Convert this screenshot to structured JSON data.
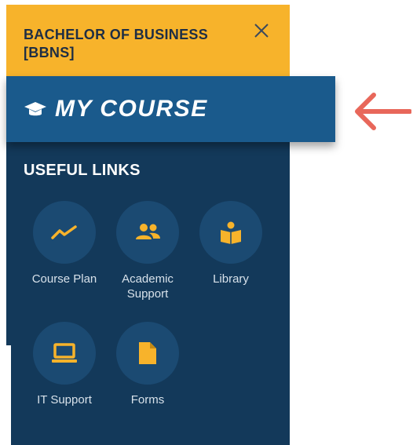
{
  "header": {
    "title_line1": "BACHELOR OF BUSINESS",
    "title_line2": "[BBNS]",
    "close_icon": "close-icon"
  },
  "course_band": {
    "label": "MY COURSE",
    "icon": "graduation-cap-icon"
  },
  "useful_links": {
    "title": "USEFUL LINKS",
    "items": [
      {
        "label": "Course Plan",
        "icon": "trend-line-icon"
      },
      {
        "label_line1": "Academic",
        "label_line2": "Support",
        "icon": "people-icon"
      },
      {
        "label": "Library",
        "icon": "reading-person-icon"
      },
      {
        "label": "IT Support",
        "icon": "laptop-icon"
      },
      {
        "label": "Forms",
        "icon": "document-icon"
      }
    ]
  },
  "annotation": {
    "icon": "left-arrow-icon",
    "color": "#e8675a"
  },
  "colors": {
    "panel": "#13395a",
    "header": "#f7b32b",
    "course_band": "#1a5a8c",
    "icon_accent": "#f7b32b"
  }
}
